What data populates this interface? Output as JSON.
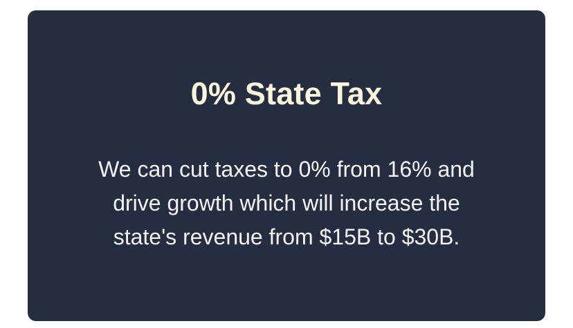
{
  "card": {
    "title": "0% State Tax",
    "body_lines": [
      "We can cut taxes to 0% from 16% and",
      "drive growth which will increase the",
      "state's revenue from $15B to $30B."
    ]
  },
  "colors": {
    "page_background": "#ffffff",
    "card_background": "#252d40",
    "title_text": "#fdf6dc",
    "body_text": "#f4f4f4"
  }
}
